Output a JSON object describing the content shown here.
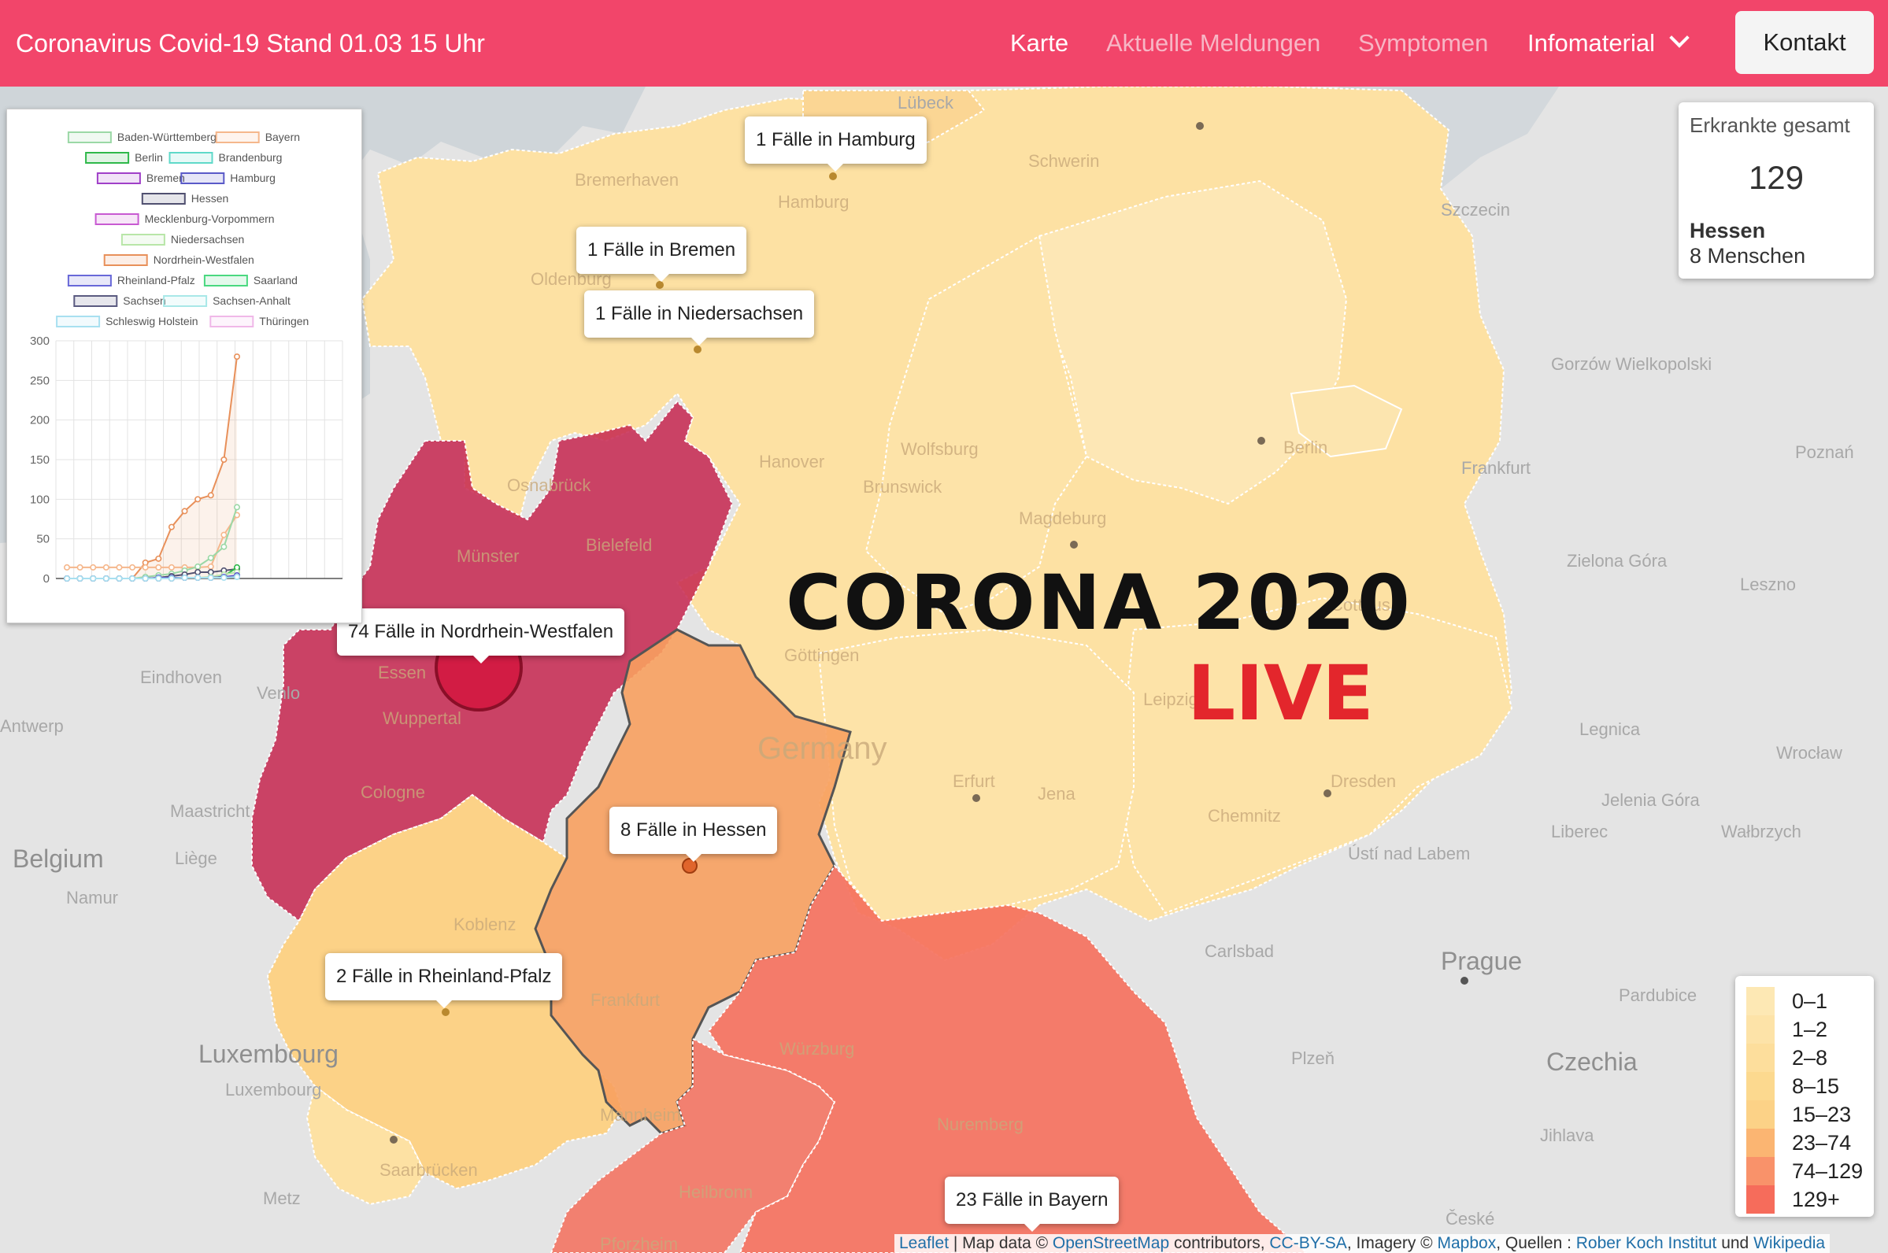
{
  "header": {
    "title": "Coronavirus Covid-19  Stand 01.03 15 Uhr",
    "nav": [
      "Karte",
      "Aktuelle Meldungen",
      "Symptomen",
      "Infomaterial"
    ],
    "contact": "Kontakt"
  },
  "colors": {
    "nav_bg": "#f2456a",
    "nrw": "#c6264f",
    "bayern": "#f56f5c",
    "hessen": "#f7a05f",
    "light": "#fcdd9c",
    "very_light": "#fde8b4"
  },
  "map_labels": {
    "cities_foreign": [
      "Lübeck",
      "Szczecin",
      "Gorzów Wielkopolski",
      "Poznań",
      "Zielona Góra",
      "Leszno",
      "Legnica",
      "Wrocław",
      "Jelenia Góra",
      "Wałbrzych",
      "Liberec",
      "Ústí nad Labem",
      "Prague",
      "Pardubice",
      "Czechia",
      "Plzeň",
      "Jihlava",
      "České",
      "Carlsbad",
      "Belgium",
      "Liège",
      "Namur",
      "Maastricht",
      "Antwerp",
      "Eindhoven",
      "Venlo",
      "Luxembourg",
      "Luxembourg",
      "Metz",
      "Frankfurt"
    ],
    "cities_de": [
      "Schwerin",
      "Hamburg",
      "Bremerhaven",
      "Oldenburg",
      "Hanover",
      "Wolfsburg",
      "Brunswick",
      "Magdeburg",
      "Berlin",
      "Cottbus",
      "Osnabrück",
      "Münster",
      "Bielefeld",
      "Göttingen",
      "Essen",
      "Wuppertal",
      "Cologne",
      "Koblenz",
      "Frankfurt",
      "Würzburg",
      "Nuremberg",
      "Mannheim",
      "Heilbronn",
      "Pforzheim",
      "Saarbrücken",
      "Erfurt",
      "Jena",
      "Leipzig",
      "Dresden",
      "Chemnitz",
      "Germany"
    ]
  },
  "popups": {
    "hamburg": "1 Fälle in Hamburg",
    "bremen": "1 Fälle in Bremen",
    "niedersachsen": "1 Fälle in Niedersachsen",
    "nrw": "74 Fälle in Nordrhein-Westfalen",
    "hessen": "8 Fälle in Hessen",
    "rlp": "2 Fälle in Rheinland-Pfalz",
    "bayern": "23 Fälle in Bayern"
  },
  "overlay": {
    "title": "CORONA 2020",
    "live": "LIVE"
  },
  "stats": {
    "title": "Erkrankte gesamt",
    "total": "129",
    "state": "Hessen",
    "people": "8 Menschen"
  },
  "legend": {
    "items": [
      {
        "label": "0–1",
        "color": "#fde8b4"
      },
      {
        "label": "1–2",
        "color": "#fde3a8"
      },
      {
        "label": "2–8",
        "color": "#fdde9c"
      },
      {
        "label": "8–15",
        "color": "#fcd98f"
      },
      {
        "label": "15–23",
        "color": "#fcd287"
      },
      {
        "label": "23–74",
        "color": "#fbb572"
      },
      {
        "label": "74–129",
        "color": "#f9926a"
      },
      {
        "label": "129+",
        "color": "#f66c5b"
      }
    ]
  },
  "attribution": {
    "leaflet": "Leaflet",
    "sep": " | Map data © ",
    "osm": "OpenStreetMap",
    "contrib": " contributors, ",
    "cc": "CC-BY-SA",
    "imagery": ", Imagery © ",
    "mapbox": "Mapbox",
    "quellen": ", Quellen : ",
    "rki": "Rober Koch Institut",
    "und": " und ",
    "wiki": "Wikipedia"
  },
  "chart_data": {
    "type": "line",
    "legend": [
      {
        "name": "Baden-Württemberg",
        "color": "#9bd8a6"
      },
      {
        "name": "Bayern",
        "color": "#f5b78c"
      },
      {
        "name": "Berlin",
        "color": "#2fb84a"
      },
      {
        "name": "Brandenburg",
        "color": "#5fd9c9"
      },
      {
        "name": "Bremen",
        "color": "#a040c8"
      },
      {
        "name": "Hamburg",
        "color": "#5a5ac8"
      },
      {
        "name": "Hessen",
        "color": "#505070"
      },
      {
        "name": "Mecklenburg-Vorpommern",
        "color": "#c85ad2"
      },
      {
        "name": "Niedersachsen",
        "color": "#b8e6a8"
      },
      {
        "name": "Nordrhein-Westfalen",
        "color": "#e8905a"
      },
      {
        "name": "Rheinland-Pfalz",
        "color": "#6868d8"
      },
      {
        "name": "Saarland",
        "color": "#4ad880"
      },
      {
        "name": "Sachsen",
        "color": "#5a5a80"
      },
      {
        "name": "Sachsen-Anhalt",
        "color": "#a8e8e8"
      },
      {
        "name": "Schleswig Holstein",
        "color": "#a8e0f0"
      },
      {
        "name": "Thüringen",
        "color": "#f0b8e8"
      }
    ],
    "y_ticks": [
      "300",
      "250",
      "200",
      "150",
      "100",
      "50",
      "0"
    ],
    "ylim": [
      0,
      300
    ],
    "series": [
      {
        "name": "Nordrhein-Westfalen",
        "color": "#e8905a",
        "fill": true,
        "values": [
          0,
          0,
          0,
          0,
          0,
          0,
          20,
          25,
          65,
          85,
          100,
          105,
          150,
          280
        ]
      },
      {
        "name": "Bayern",
        "color": "#f5b78c",
        "fill": false,
        "values": [
          14,
          14,
          14,
          14,
          14,
          14,
          14,
          14,
          14,
          14,
          14,
          15,
          55,
          80
        ]
      },
      {
        "name": "Baden-Württemberg",
        "color": "#9bd8a6",
        "fill": false,
        "values": [
          0,
          0,
          0,
          0,
          0,
          0,
          2,
          4,
          6,
          10,
          15,
          26,
          40,
          90
        ]
      },
      {
        "name": "Hessen",
        "color": "#505070",
        "fill": false,
        "values": [
          0,
          0,
          0,
          0,
          0,
          0,
          0,
          1,
          3,
          5,
          8,
          8,
          10,
          12
        ]
      },
      {
        "name": "Berlin",
        "color": "#2fb84a",
        "fill": false,
        "values": [
          0,
          0,
          0,
          0,
          0,
          0,
          0,
          0,
          0,
          1,
          1,
          1,
          3,
          14
        ]
      },
      {
        "name": "Niedersachsen",
        "color": "#b8e6a8",
        "fill": false,
        "values": [
          0,
          0,
          0,
          0,
          0,
          0,
          0,
          0,
          1,
          1,
          1,
          2,
          5,
          8
        ]
      },
      {
        "name": "Bremen",
        "color": "#a040c8",
        "fill": false,
        "values": [
          0,
          0,
          0,
          0,
          0,
          0,
          0,
          0,
          0,
          1,
          1,
          1,
          2,
          3
        ]
      },
      {
        "name": "Hamburg",
        "color": "#5a5ac8",
        "fill": false,
        "values": [
          0,
          0,
          0,
          0,
          0,
          0,
          0,
          1,
          1,
          1,
          1,
          1,
          2,
          4
        ]
      },
      {
        "name": "Schleswig Holstein",
        "color": "#a8e0f0",
        "fill": false,
        "values": [
          0,
          0,
          0,
          0,
          0,
          0,
          0,
          0,
          0,
          1,
          1,
          1,
          1,
          2
        ]
      }
    ]
  }
}
